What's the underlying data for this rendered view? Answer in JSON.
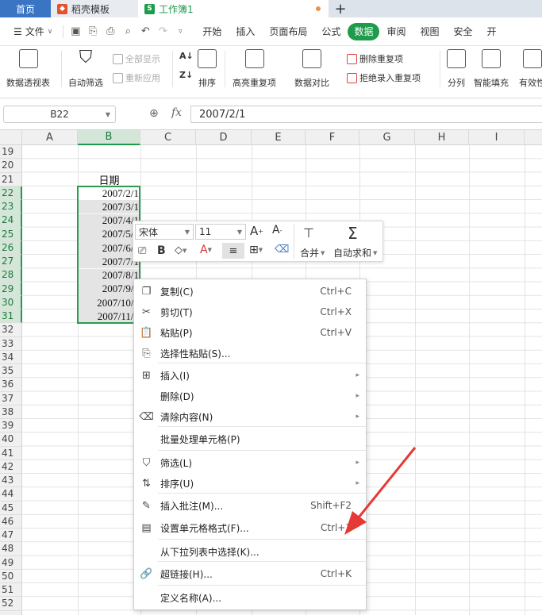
{
  "tabs": {
    "home": "首页",
    "template": "稻壳模板",
    "workbook": "工作簿1",
    "add": "+"
  },
  "menubar": {
    "file": "文件",
    "items": [
      "开始",
      "插入",
      "页面布局",
      "公式",
      "数据",
      "审阅",
      "视图",
      "安全",
      "开"
    ],
    "active": "数据"
  },
  "ribbon": {
    "pivot": "数据透视表",
    "autofilter": "自动筛选",
    "show_all": "全部显示",
    "reapply": "重新应用",
    "sort": "排序",
    "highlight_dup": "高亮重复项",
    "data_compare": "数据对比",
    "remove_dup": "删除重复项",
    "reject_dup": "拒绝录入重复项",
    "split": "分列",
    "smart_fill": "智能填充",
    "validity": "有效性"
  },
  "formula_bar": {
    "name_box": "B22",
    "fx": "fx",
    "value": "2007/2/1"
  },
  "columns": [
    "A",
    "B",
    "C",
    "D",
    "E",
    "F",
    "G",
    "H",
    "I"
  ],
  "selected_column": "B",
  "rows": [
    "19",
    "20",
    "21",
    "22",
    "23",
    "24",
    "25",
    "26",
    "27",
    "28",
    "29",
    "30",
    "31",
    "32",
    "33",
    "34",
    "35",
    "36",
    "37",
    "38",
    "39",
    "40",
    "41",
    "42",
    "43",
    "44",
    "45",
    "46",
    "47",
    "48",
    "49",
    "50",
    "51",
    "52"
  ],
  "header_cell": "日期",
  "dates": [
    "2007/2/1",
    "2007/3/1",
    "2007/4/1",
    "2007/5/1",
    "2007/6/1",
    "2007/7/1",
    "2007/8/1",
    "2007/9/1",
    "2007/10/1",
    "2007/11/1"
  ],
  "mini_toolbar": {
    "font": "宋体",
    "size": "11",
    "merge": "合并",
    "autosum": "自动求和"
  },
  "context_menu": [
    {
      "label": "复制(C)",
      "shortcut": "Ctrl+C",
      "icon": "copy-icon"
    },
    {
      "label": "剪切(T)",
      "shortcut": "Ctrl+X",
      "icon": "scissors-icon"
    },
    {
      "label": "粘贴(P)",
      "shortcut": "Ctrl+V",
      "icon": "paste-icon"
    },
    {
      "label": "选择性粘贴(S)...",
      "shortcut": "",
      "icon": "paste-special-icon"
    },
    {
      "label": "插入(I)",
      "shortcut": "",
      "icon": "insert-icon",
      "submenu": true
    },
    {
      "label": "删除(D)",
      "shortcut": "",
      "icon": "",
      "submenu": true
    },
    {
      "label": "清除内容(N)",
      "shortcut": "",
      "icon": "eraser-icon",
      "submenu": true
    },
    {
      "label": "批量处理单元格(P)",
      "shortcut": "",
      "icon": ""
    },
    {
      "label": "筛选(L)",
      "shortcut": "",
      "icon": "filter-icon",
      "submenu": true
    },
    {
      "label": "排序(U)",
      "shortcut": "",
      "icon": "sort-icon",
      "submenu": true
    },
    {
      "label": "插入批注(M)...",
      "shortcut": "Shift+F2",
      "icon": "comment-icon"
    },
    {
      "label": "设置单元格格式(F)...",
      "shortcut": "Ctrl+1",
      "icon": "format-cells-icon"
    },
    {
      "label": "从下拉列表中选择(K)...",
      "shortcut": "",
      "icon": ""
    },
    {
      "label": "超链接(H)...",
      "shortcut": "Ctrl+K",
      "icon": "link-icon"
    },
    {
      "label": "定义名称(A)...",
      "shortcut": "",
      "icon": ""
    }
  ],
  "colors": {
    "accent_green": "#1f9b4c",
    "home_tab": "#3a75c4",
    "arrow_red": "#e53935"
  }
}
